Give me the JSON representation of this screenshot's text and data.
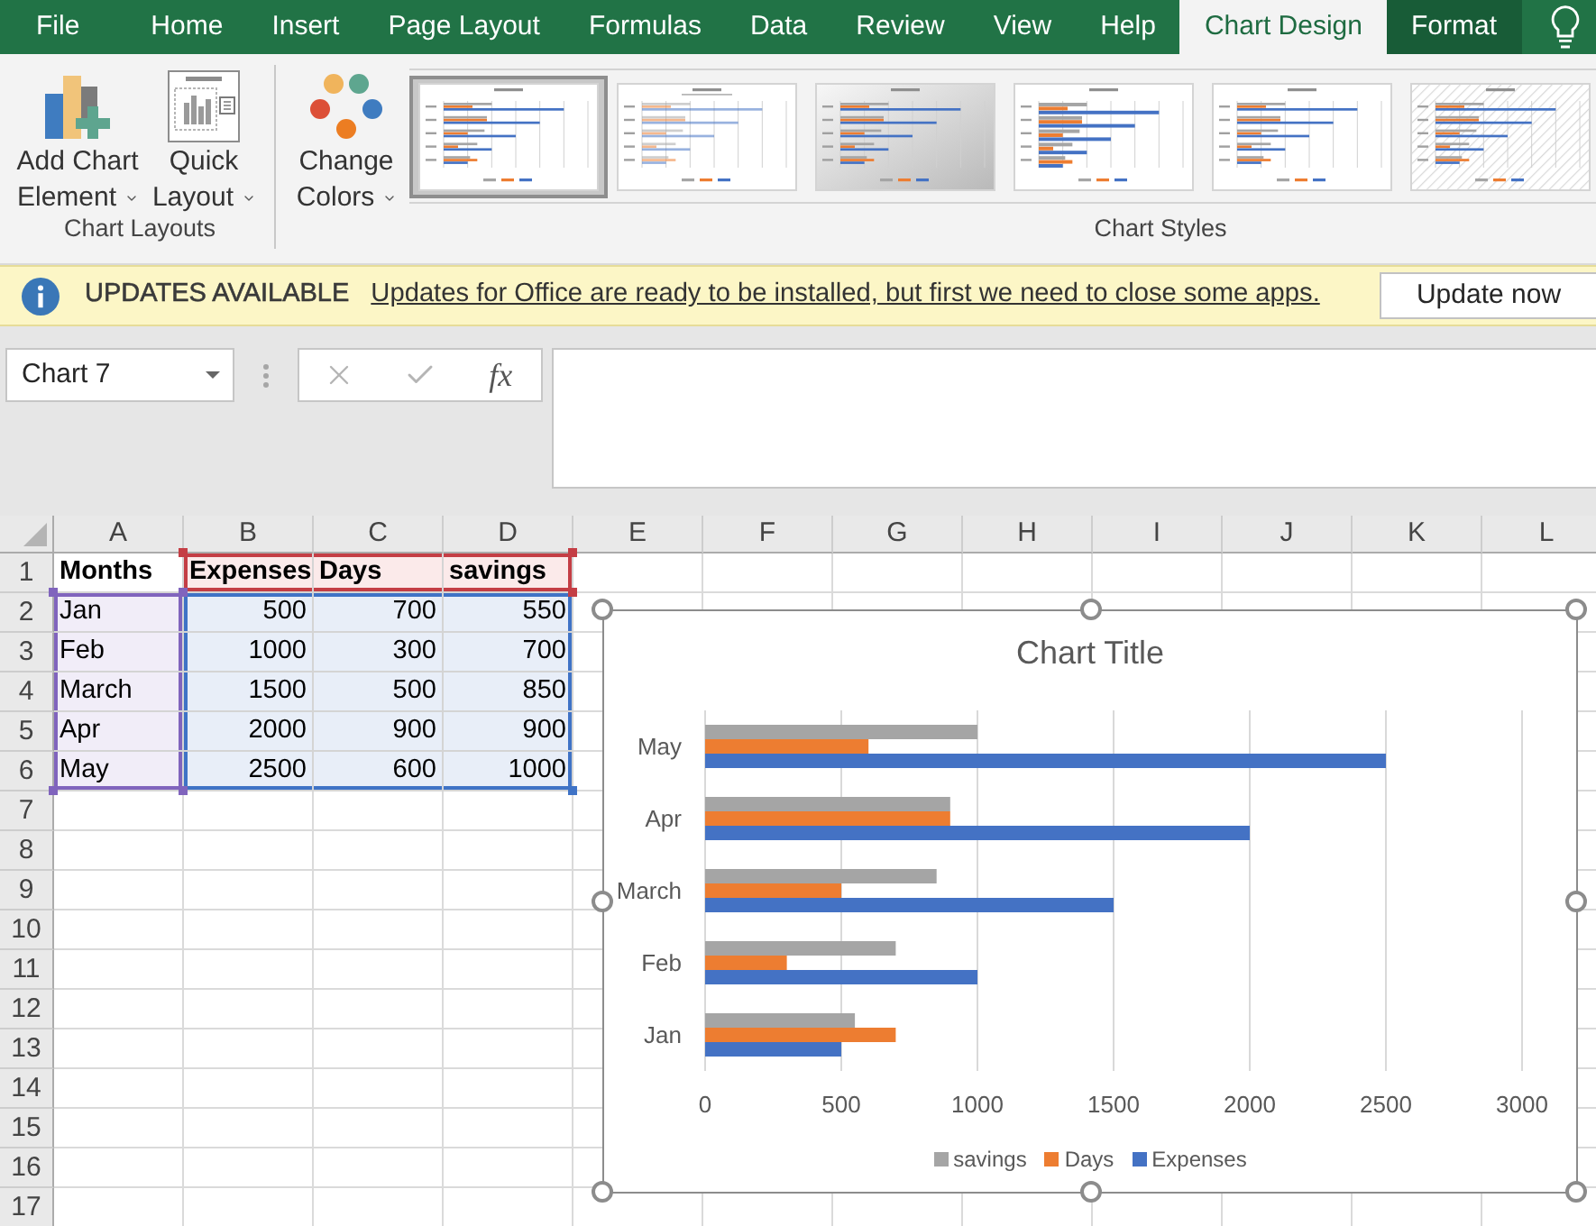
{
  "tabs": [
    {
      "label": "File",
      "selected": false,
      "contextual": false
    },
    {
      "label": "Home",
      "selected": false,
      "contextual": false
    },
    {
      "label": "Insert",
      "selected": false,
      "contextual": false
    },
    {
      "label": "Page Layout",
      "selected": false,
      "contextual": false
    },
    {
      "label": "Formulas",
      "selected": false,
      "contextual": false
    },
    {
      "label": "Data",
      "selected": false,
      "contextual": false
    },
    {
      "label": "Review",
      "selected": false,
      "contextual": false
    },
    {
      "label": "View",
      "selected": false,
      "contextual": false
    },
    {
      "label": "Help",
      "selected": false,
      "contextual": false
    },
    {
      "label": "Chart Design",
      "selected": true,
      "contextual": true
    },
    {
      "label": "Format",
      "selected": false,
      "contextual": true
    }
  ],
  "ribbon": {
    "groups": [
      {
        "label": "Chart Layouts",
        "buttons": [
          {
            "kind": "add_chart_element",
            "lines": [
              "Add Chart",
              "Element"
            ],
            "dropdown": true
          },
          {
            "kind": "quick_layout",
            "lines": [
              "Quick",
              "Layout"
            ],
            "dropdown": true
          }
        ]
      },
      {
        "label": "Chart Styles",
        "buttons": [
          {
            "kind": "change_colors",
            "lines": [
              "Change",
              "Colors"
            ],
            "dropdown": true
          }
        ],
        "styles": [
          {
            "kind": "plain",
            "selected": true
          },
          {
            "kind": "outlined",
            "selected": false
          },
          {
            "kind": "shaded",
            "selected": false
          },
          {
            "kind": "wide",
            "selected": false
          },
          {
            "kind": "plain",
            "selected": false
          },
          {
            "kind": "hatched",
            "selected": false
          }
        ]
      }
    ]
  },
  "update_bar": {
    "title": "UPDATES AVAILABLE",
    "message": "Updates for Office are ready to be installed, but first we need to close some apps.",
    "button": "Update now"
  },
  "formula_bar": {
    "name_box": "Chart 7",
    "buttons": [
      {
        "kind": "cancel",
        "disabled": true
      },
      {
        "kind": "enter",
        "disabled": true
      },
      {
        "kind": "function",
        "label": "fx",
        "disabled": false
      }
    ]
  },
  "sheet": {
    "columns": [
      "A",
      "B",
      "C",
      "D",
      "E",
      "F",
      "G",
      "H",
      "I",
      "J",
      "K",
      "L"
    ],
    "rows": [
      {
        "number": "1",
        "cells": [
          {
            "text": "Months",
            "kind": "header"
          },
          {
            "text": "Expenses",
            "kind": "series_name"
          },
          {
            "text": "Days",
            "kind": "series_name"
          },
          {
            "text": "savings",
            "kind": "series_name"
          }
        ]
      },
      {
        "number": "2",
        "cells": [
          {
            "text": "Jan",
            "kind": "category"
          },
          {
            "text": "500",
            "kind": "value"
          },
          {
            "text": "700",
            "kind": "value"
          },
          {
            "text": "550",
            "kind": "value"
          }
        ]
      },
      {
        "number": "3",
        "cells": [
          {
            "text": "Feb",
            "kind": "category"
          },
          {
            "text": "1000",
            "kind": "value"
          },
          {
            "text": "300",
            "kind": "value"
          },
          {
            "text": "700",
            "kind": "value"
          }
        ]
      },
      {
        "number": "4",
        "cells": [
          {
            "text": "March",
            "kind": "category"
          },
          {
            "text": "1500",
            "kind": "value"
          },
          {
            "text": "500",
            "kind": "value"
          },
          {
            "text": "850",
            "kind": "value"
          }
        ]
      },
      {
        "number": "5",
        "cells": [
          {
            "text": "Apr",
            "kind": "category"
          },
          {
            "text": "2000",
            "kind": "value"
          },
          {
            "text": "900",
            "kind": "value"
          },
          {
            "text": "900",
            "kind": "value"
          }
        ]
      },
      {
        "number": "6",
        "cells": [
          {
            "text": "May",
            "kind": "category"
          },
          {
            "text": "2500",
            "kind": "value"
          },
          {
            "text": "600",
            "kind": "value"
          },
          {
            "text": "1000",
            "kind": "value"
          }
        ]
      },
      {
        "number": "7"
      },
      {
        "number": "8"
      },
      {
        "number": "9"
      },
      {
        "number": "10"
      },
      {
        "number": "11"
      },
      {
        "number": "12"
      },
      {
        "number": "13"
      },
      {
        "number": "14"
      },
      {
        "number": "15"
      },
      {
        "number": "16"
      },
      {
        "number": "17"
      }
    ]
  },
  "chart": {
    "selected": true,
    "chart_data": {
      "type": "bar",
      "orientation": "horizontal",
      "title": "Chart Title",
      "categories": [
        "May",
        "Apr",
        "March",
        "Feb",
        "Jan"
      ],
      "series": [
        {
          "name": "savings",
          "color": "#a5a5a5",
          "values": [
            1000,
            900,
            850,
            700,
            550
          ]
        },
        {
          "name": "Days",
          "color": "#ed7d31",
          "values": [
            600,
            900,
            500,
            300,
            700
          ]
        },
        {
          "name": "Expenses",
          "color": "#4472c4",
          "values": [
            2500,
            2000,
            1500,
            1000,
            500
          ]
        }
      ],
      "xlim": [
        0,
        3000
      ],
      "xticks": [
        {
          "value": 0,
          "label": "0"
        },
        {
          "value": 500,
          "label": "500"
        },
        {
          "value": 1000,
          "label": "1000"
        },
        {
          "value": 1500,
          "label": "1500"
        },
        {
          "value": 2000,
          "label": "2000"
        },
        {
          "value": 2500,
          "label": "2500"
        },
        {
          "value": 3000,
          "label": "3000"
        }
      ],
      "grid": true,
      "legend": "bottom"
    }
  }
}
